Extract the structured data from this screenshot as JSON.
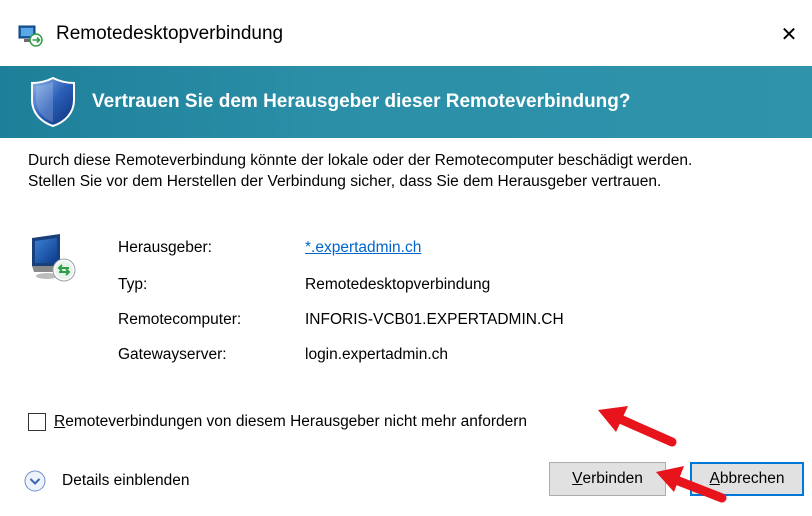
{
  "window": {
    "title": "Remotedesktopverbindung",
    "close_glyph": "✕"
  },
  "banner": {
    "text": "Vertrauen Sie dem Herausgeber dieser Remoteverbindung?",
    "color": "#2b8fa8"
  },
  "description": {
    "line1": "Durch diese Remoteverbindung könnte der lokale oder der Remotecomputer beschädigt werden.",
    "line2": "Stellen Sie vor dem Herstellen der Verbindung sicher, dass Sie dem Herausgeber vertrauen."
  },
  "details": {
    "publisher_label": "Herausgeber:",
    "publisher_value": "*.expertadmin.ch",
    "type_label": "Typ:",
    "type_value": "Remotedesktopverbindung",
    "remote_label": "Remotecomputer:",
    "remote_value": "INFORIS-VCB01.EXPERTADMIN.CH",
    "gateway_label": "Gatewayserver:",
    "gateway_value": "login.expertadmin.ch"
  },
  "checkbox": {
    "accel": "R",
    "label_rest": "emoteverbindungen von diesem Herausgeber nicht mehr anfordern",
    "checked": false
  },
  "footer": {
    "details_toggle": "Details einblenden",
    "connect_accel": "V",
    "connect_rest": "erbinden",
    "cancel_accel": "A",
    "cancel_rest": "bbrechen"
  },
  "annotations": {
    "arrow_color": "#e8141b"
  },
  "icons": {
    "title": "rdp-app-icon",
    "shield": "shield-icon",
    "computer": "remote-computer-icon",
    "expand": "chevron-down-circle-icon"
  }
}
